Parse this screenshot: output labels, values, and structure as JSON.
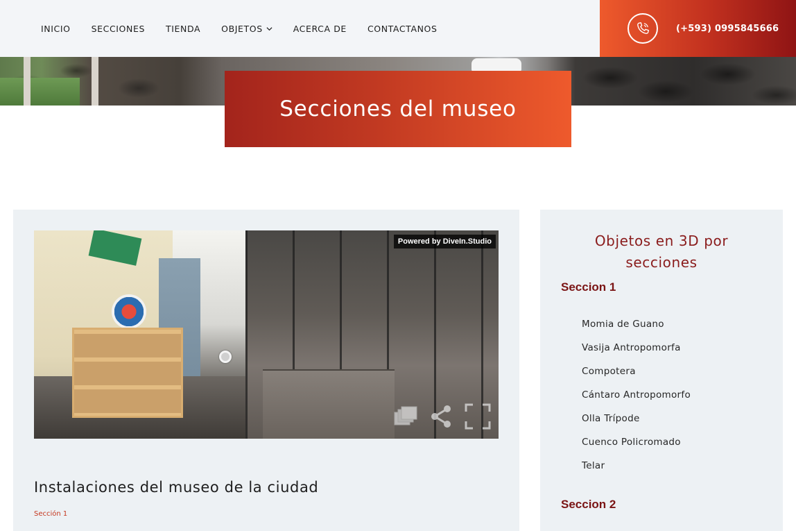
{
  "nav": {
    "items": [
      {
        "label": "INICIO"
      },
      {
        "label": "SECCIONES"
      },
      {
        "label": "TIENDA"
      },
      {
        "label": "OBJETOS",
        "has_dropdown": true
      },
      {
        "label": "ACERCA DE"
      },
      {
        "label": "CONTACTANOS"
      }
    ]
  },
  "contact": {
    "phone": "(+593) 0995845666",
    "icon": "phone-icon"
  },
  "hero": {
    "title": "Secciones del museo"
  },
  "tour": {
    "badge": "Powered by DiveIn.Studio",
    "controls": [
      "gallery-icon",
      "share-icon",
      "fullscreen-icon"
    ]
  },
  "card": {
    "title": "Instalaciones del museo de la ciudad",
    "tag": "Sección 1"
  },
  "sidebar": {
    "heading_line1": "Objetos en 3D por",
    "heading_line2": "secciones",
    "sections": [
      {
        "title": "Seccion 1",
        "items": [
          "Momia de Guano",
          "Vasija Antropomorfa",
          "Compotera",
          "Cántaro Antropomorfo",
          "Olla Trípode",
          "Cuenco Policromado",
          "Telar"
        ]
      },
      {
        "title": "Seccion 2",
        "items": []
      }
    ]
  },
  "colors": {
    "accent_orange": "#ee5a2c",
    "accent_red": "#8f1414",
    "heading_red": "#8a1c1c",
    "card_bg": "#edf1f4",
    "nav_bg": "#f3f5f8"
  }
}
